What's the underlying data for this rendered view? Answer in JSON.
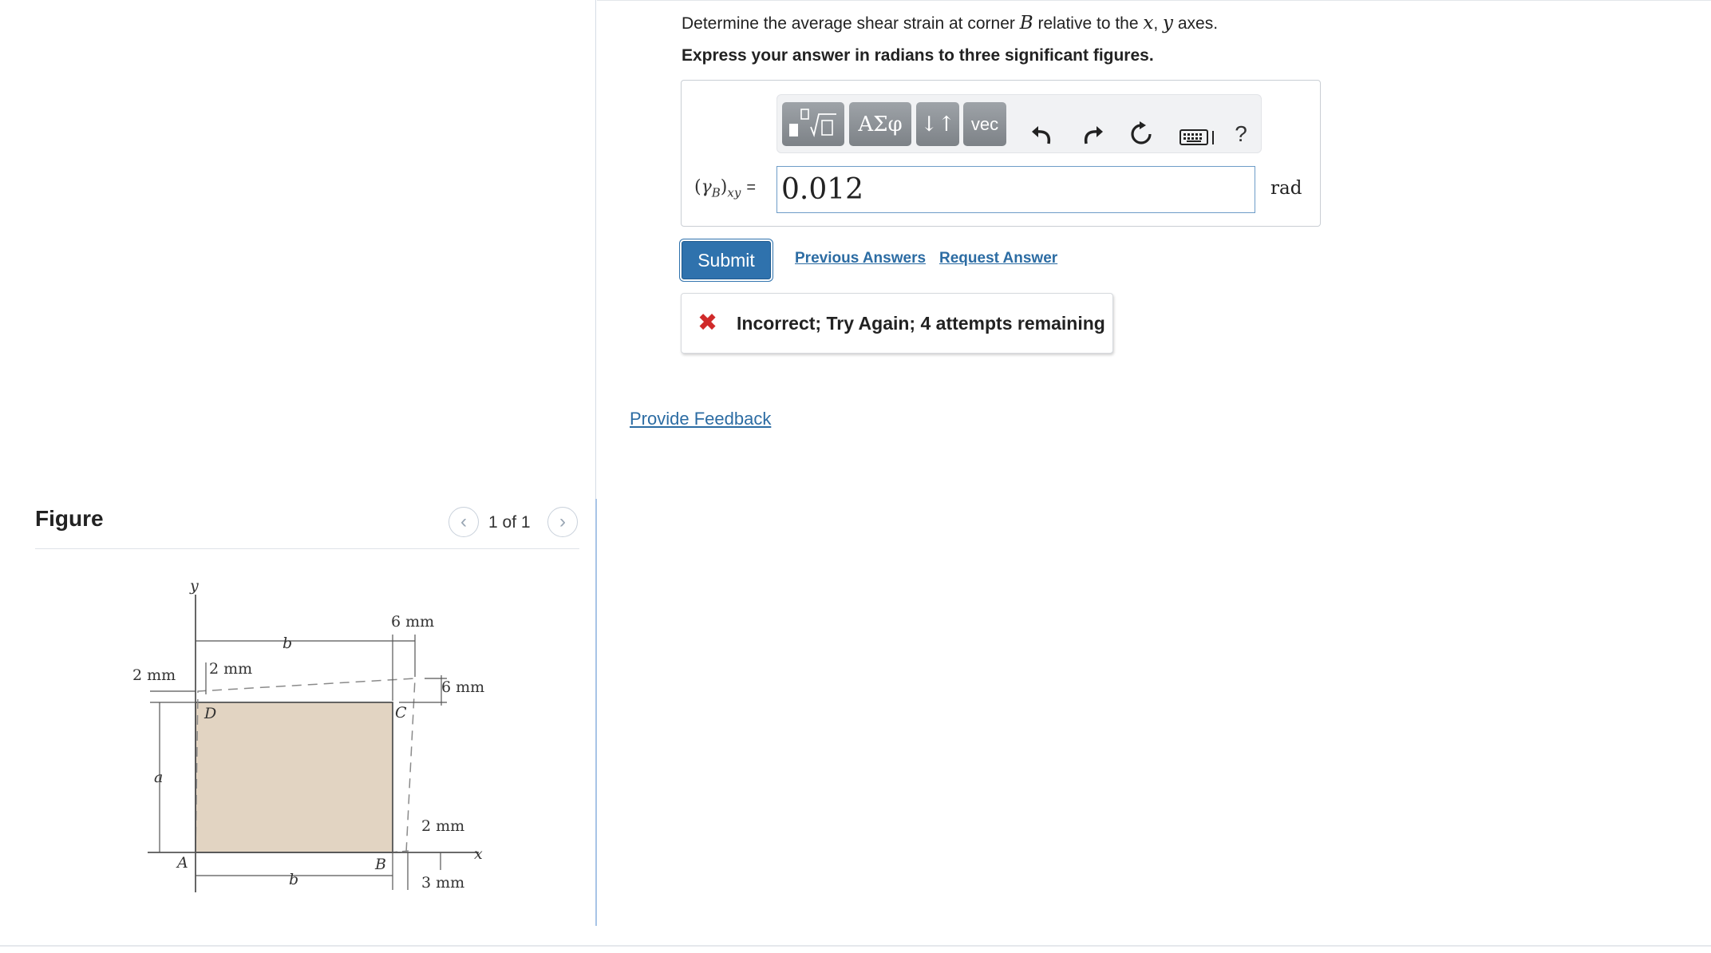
{
  "question": {
    "text_before": "Determine the average shear strain at corner ",
    "corner": "B",
    "text_middle": " relative to the ",
    "axis_x": "x",
    "comma": ",",
    "axis_y": "y",
    "text_after": " axes.",
    "instruction": "Express your answer in radians to three significant figures."
  },
  "toolbar": {
    "greek_label": "ΑΣφ",
    "arrows_label": "↓↑",
    "vec_label": "vec",
    "help_label": "?"
  },
  "answer": {
    "label": "(γB)xy",
    "equals": "=",
    "value": "0.012",
    "unit": "rad"
  },
  "actions": {
    "submit_label": "Submit",
    "previous_answers_label": "Previous Answers",
    "request_answer_label": "Request Answer"
  },
  "feedback": {
    "message": "Incorrect; Try Again; 4 attempts remaining"
  },
  "provide_feedback_label": "Provide Feedback",
  "figure": {
    "heading": "Figure",
    "page_indicator": "1 of 1",
    "labels": {
      "y_axis": "y",
      "x_axis": "x",
      "top_dim": "6 mm",
      "left_dim": "2 mm",
      "inner_dim": "2 mm",
      "right_top_dim": "6 mm",
      "right_bottom_dim": "2 mm",
      "bottom_right_dim": "3 mm",
      "side_a": "a",
      "side_b_top": "b",
      "side_b_bottom": "b",
      "corner_a": "A",
      "corner_b": "B",
      "corner_c": "C",
      "corner_d": "D"
    },
    "colors": {
      "plate_fill": "#e2d4c2",
      "plate_stroke": "#555555"
    }
  },
  "colors": {
    "accent": "#2f72ad",
    "link": "#2c6ca3",
    "error": "#d02a2a",
    "input_border": "#6d9cc8"
  }
}
